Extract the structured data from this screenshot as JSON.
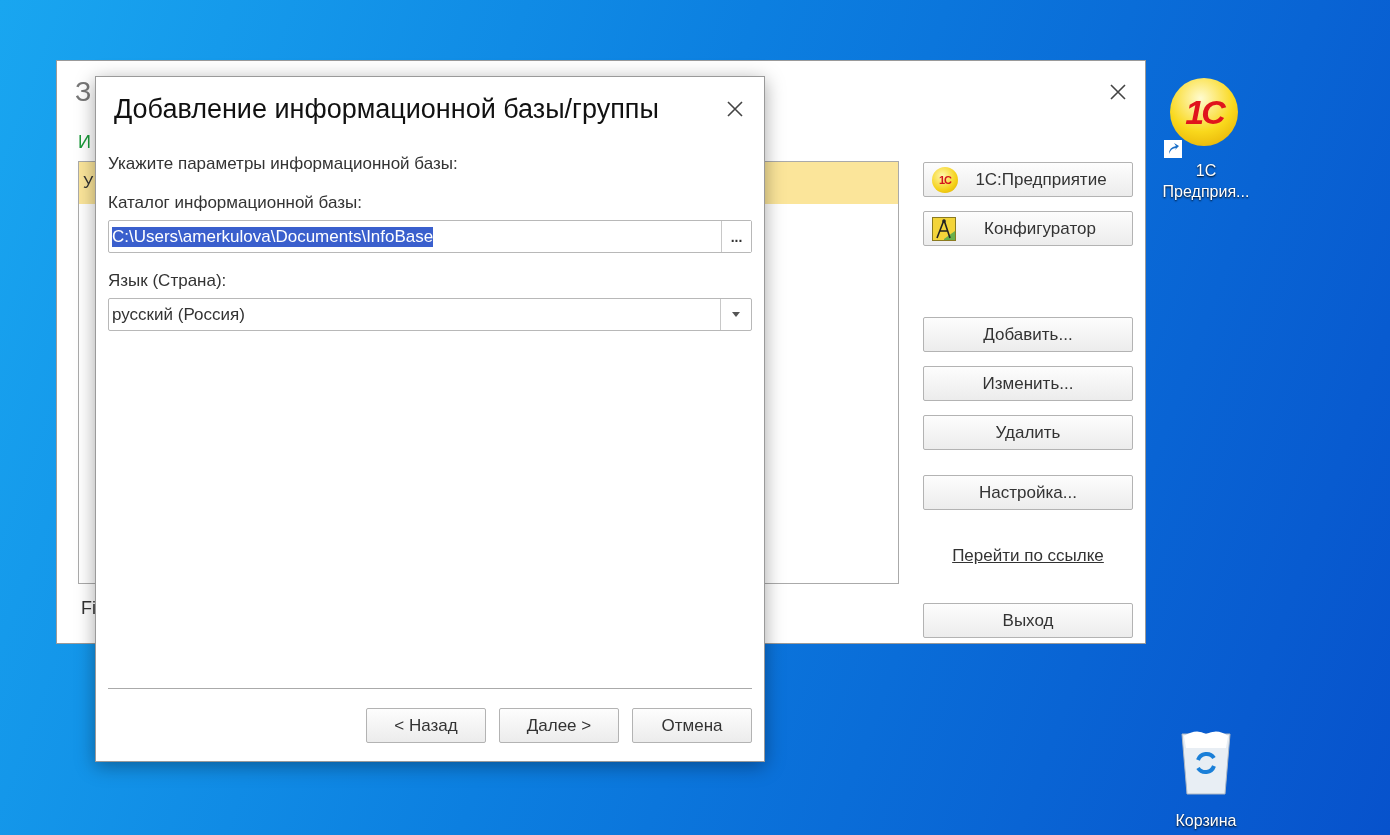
{
  "background_window": {
    "title": "З",
    "section_label": "И",
    "list_rows": [
      {
        "text": "У",
        "selected": true
      }
    ],
    "footer_text": "Fi",
    "launch_buttons": [
      {
        "label": "1С:Предприятие",
        "kind": "enterprise",
        "icon_text": "1С"
      },
      {
        "label": "Конфигуратор",
        "kind": "designer"
      }
    ],
    "action_buttons": [
      {
        "label": "Добавить...",
        "kind": "first"
      },
      {
        "label": "Изменить...",
        "kind": "next"
      },
      {
        "label": "Удалить",
        "kind": "next"
      },
      {
        "label": "Настройка...",
        "kind": "group"
      }
    ],
    "link": "Перейти по ссылке",
    "exit_button": "Выход"
  },
  "dialog": {
    "title": "Добавление информационной базы/группы",
    "prompt": "Укажите параметры информационной базы:",
    "catalog": {
      "label": "Каталог информационной базы:",
      "value": "C:\\Users\\amerkulova\\Documents\\InfoBase",
      "text_selected": true,
      "browse_button": "..."
    },
    "language": {
      "label": "Язык (Страна):",
      "value": "русский (Россия)"
    },
    "buttons": [
      "< Назад",
      "Далее >",
      "Отмена"
    ]
  },
  "desktop_icons": [
    {
      "label": "1С Предприя...",
      "kind": "app",
      "icon_text": "1С"
    },
    {
      "label": "Корзина",
      "kind": "trash"
    }
  ]
}
